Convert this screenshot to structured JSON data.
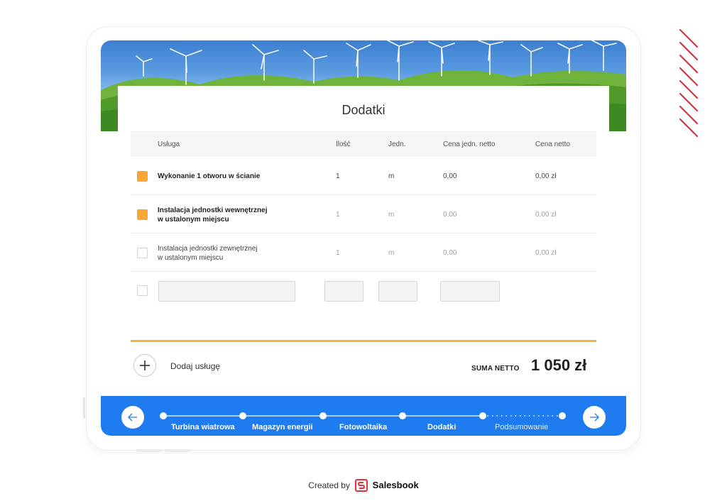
{
  "card": {
    "title": "Dodatki"
  },
  "table": {
    "columns": [
      "Usługa",
      "Ilość",
      "Jedn.",
      "Cena jedn. netto",
      "Cena netto"
    ],
    "rows": [
      {
        "checked": true,
        "name_line1": "Wykonanie 1 otworu w ścianie",
        "name_line2": "",
        "qty": "1",
        "unit": "m",
        "unit_price": "0,00",
        "price": "0,00 zł"
      },
      {
        "checked": true,
        "name_line1": "Instalacja jednostki wewnętrznej",
        "name_line2": "w ustalonym miejscu",
        "qty": "1",
        "unit": "m",
        "unit_price": "0,00",
        "price": "0,00 zł"
      },
      {
        "checked": false,
        "name_line1": "Instalacja jednostki zewnętrznej",
        "name_line2": "w ustalonym miejscu",
        "qty": "1",
        "unit": "m",
        "unit_price": "0,00",
        "price": "0,00 zł"
      }
    ],
    "new_row": {
      "name": "",
      "qty": "",
      "unit": "",
      "unit_price": ""
    }
  },
  "add_service": {
    "label": "Dodaj usługę"
  },
  "summary": {
    "label": "SUMA NETTO",
    "value": "1 050 zł"
  },
  "stepper": {
    "steps": [
      "Turbina wiatrowa",
      "Magazyn energii",
      "Fotowoltaika",
      "Dodatki",
      "Podsumowanie"
    ],
    "current_step": "Dodatki"
  },
  "footer": {
    "prefix": "Created by",
    "brand": "Salesbook"
  },
  "colors": {
    "accent_orange": "#f7a732",
    "nav_blue": "#1e7bf0",
    "brand_red": "#e8303a"
  },
  "icons": {
    "add": "plus-icon",
    "prev": "arrow-left-icon",
    "next": "arrow-right-icon",
    "logo": "salesbook-logo-icon"
  }
}
